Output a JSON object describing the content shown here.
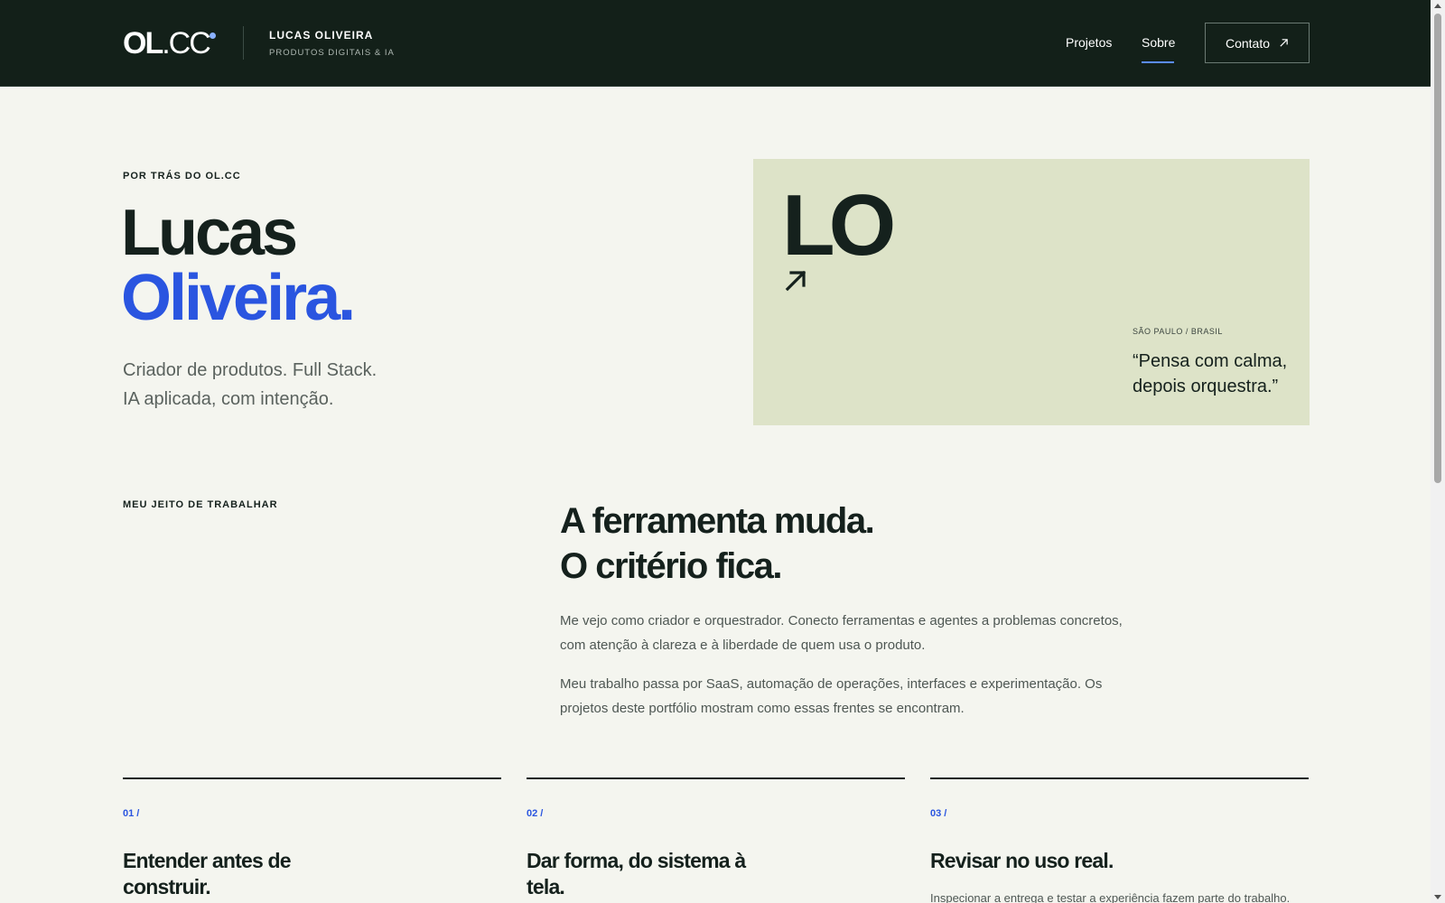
{
  "header": {
    "logo_ol": "OL",
    "logo_cc": ".CC",
    "brand_name": "LUCAS OLIVEIRA",
    "brand_sub": "PRODUTOS DIGITAIS & IA",
    "nav": [
      {
        "label": "Projetos"
      },
      {
        "label": "Sobre",
        "active": true
      }
    ],
    "contact_label": "Contato",
    "accent_color": "#5b8cff"
  },
  "hero": {
    "eyebrow": "POR TRÁS DO OL.CC",
    "title_line1": "Lucas",
    "title_line2": "Oliveira.",
    "subtitle_line1": "Criador de produtos. Full Stack.",
    "subtitle_line2": "IA aplicada, com intenção."
  },
  "card": {
    "initials": "LO",
    "location": "SÃO PAULO / BRASIL",
    "quote": "“Pensa com calma, depois orquestra.”",
    "background": "#dde3c8"
  },
  "work": {
    "eyebrow": "MEU JEITO DE TRABALHAR",
    "statement_line1": "A ferramenta muda.",
    "statement_line2": "O critério fica.",
    "paragraph1": "Me vejo como criador e orquestrador. Conecto ferramentas e agentes a problemas concretos, com atenção à clareza e à liberdade de quem usa o produto.",
    "paragraph2": "Meu trabalho passa por SaaS, automação de operações, interfaces e experimentação. Os projetos deste portfólio mostram como essas frentes se encontram."
  },
  "principles": [
    {
      "number": "01 /",
      "title": "Entender antes de construir.",
      "text": ""
    },
    {
      "number": "02 /",
      "title": "Dar forma, do sistema à tela.",
      "text": ""
    },
    {
      "number": "03 /",
      "title": "Revisar no uso real.",
      "text": "Inspecionar a entrega e testar a experiência fazem parte do trabalho."
    }
  ],
  "colors": {
    "dark": "#132019",
    "blue": "#2a55e0",
    "page_bg": "#f4f5ef"
  }
}
